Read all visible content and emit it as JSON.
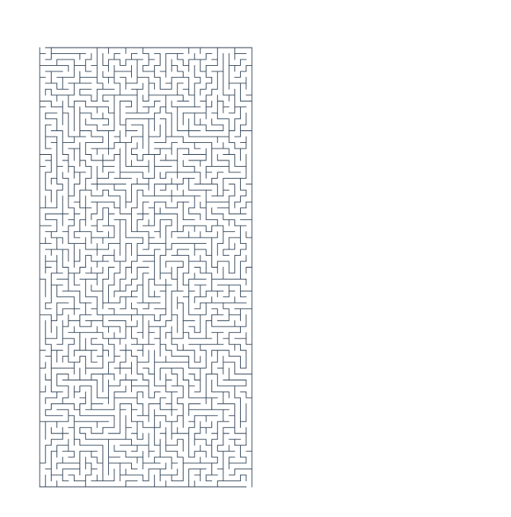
{
  "maze_size_input": {
    "value": "37",
    "placeholder": ""
  },
  "maze": {
    "cells": 37,
    "wall_color": "#2f4256",
    "background_color": "#ffffff"
  }
}
